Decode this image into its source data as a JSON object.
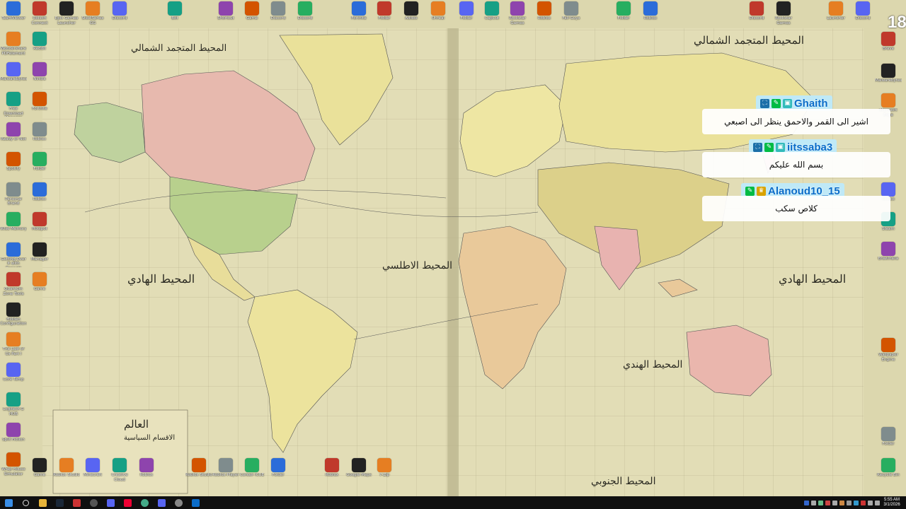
{
  "desktop_icons_top": [
    "TeamViewer",
    "Ubisoft Connect",
    "Epic Games Launcher",
    "SteelSeries GG",
    "Discord",
    "Bot",
    "Shortcut",
    "Game",
    "Discord",
    "Discord",
    "Fortnite",
    "Folder",
    "Adobe",
    "Unreal",
    "Folder",
    "CapCut",
    "Rockstar Games",
    "Roblox",
    "Fall Guys",
    "Folder",
    "Roblox",
    "Discord",
    "Rockstar Games",
    "Launcher",
    "Discord"
  ],
  "desktop_icons_left": [
    "Wondershare PDFelement",
    "Malwarebytes",
    "Free Download Manager",
    "Ready or Not",
    "Spotify",
    "Personal Brand",
    "Wise Memory",
    "Getting Over It with Bennett",
    "Quantum Zone Tools",
    "Hidden Configuration",
    "The Last of Us Part I",
    "Core Temp",
    "Logitech G HUB",
    "Split Fiction",
    "Wrap House Simulator"
  ],
  "desktop_icons_left2": [
    "Reddit",
    "Nvidia",
    "Fortnite",
    "Roblox",
    "Folder",
    "Roblox",
    "Hotspot",
    "Manager",
    "Game"
  ],
  "desktop_icons_right": [
    "Brave",
    "Malwarebytes",
    "Microsoft Edge",
    "Roblox",
    "Steam",
    "Brawlhalla",
    "Wallpaper Engine",
    "Folder",
    "Recycle Bin"
  ],
  "desktop_icons_bottom": [
    "Game",
    "Roblox Studio",
    "Minecraft",
    "Creative Cloud",
    "Roblox",
    "Roblox Studio",
    "Roblox Player",
    "Corsair iCUE",
    "Folder",
    "Roblox",
    "Google Maps",
    "7-Zip"
  ],
  "chat": {
    "count": "18",
    "messages": [
      {
        "user": "Ghaith",
        "color": "#0a6cc9",
        "text": "اشير الى القمر والاحمق ينظر الى اصبعي"
      },
      {
        "user": "iitssaba3",
        "color": "#0a6cc9",
        "text": "بسم الله عليكم"
      },
      {
        "user": "Alanoud10_15",
        "color": "#0a6cc9",
        "text": "كلاص سكب"
      }
    ]
  },
  "map": {
    "labels": [
      "المحيط المتجمد الشمالي",
      "المحيط المتجمد الشمالي",
      "المحيط الهادي",
      "المحيط الهادي",
      "المحيط الاطلسي",
      "المحيط الهندي",
      "المحيط الجنوبي",
      "العالم",
      "الاقسام السياسية"
    ]
  },
  "taskbar": {
    "time": "5:55 AM",
    "date": "3/1/2026"
  }
}
